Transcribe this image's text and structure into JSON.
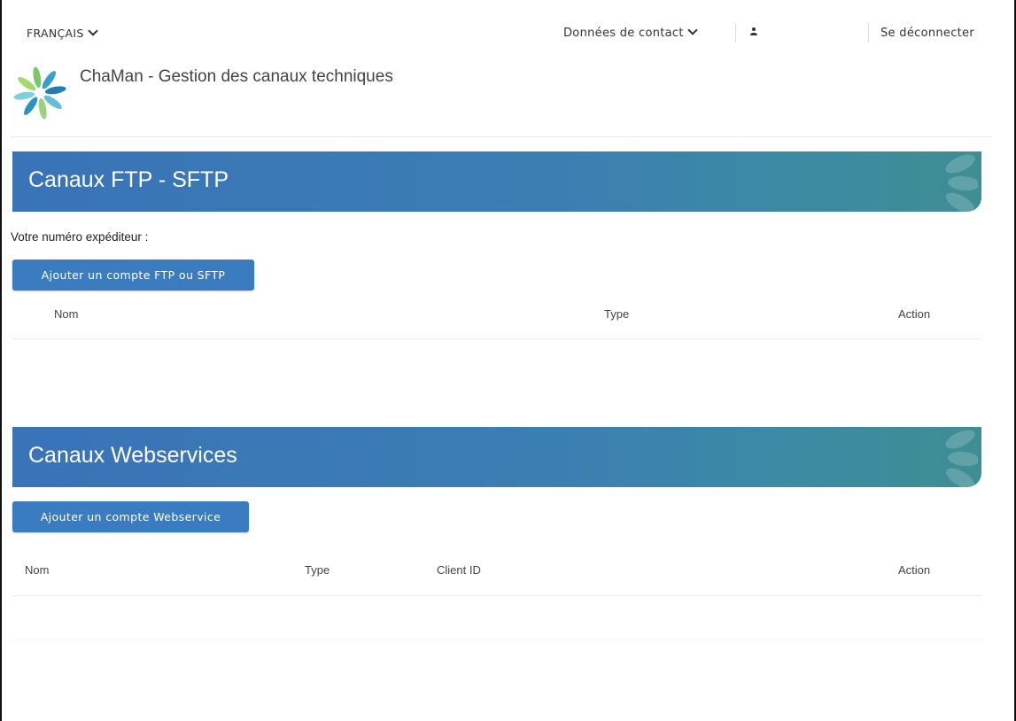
{
  "topbar": {
    "language": "FRANÇAIS",
    "contact": "Données de contact",
    "logout": "Se déconnecter"
  },
  "header": {
    "title": "ChaMan - Gestion des canaux techniques"
  },
  "ftp_section": {
    "title": "Canaux FTP - SFTP",
    "sender_label": "Votre numéro expéditeur :",
    "add_button": "Ajouter un compte FTP ou SFTP",
    "columns": [
      "Nom",
      "Type",
      "Action"
    ]
  },
  "ws_section": {
    "title": "Canaux Webservices",
    "add_button": "Ajouter un compte Webservice",
    "columns": [
      "Nom",
      "Type",
      "Client ID",
      "Action"
    ]
  },
  "colors": {
    "accent": "#3b7bbf",
    "banner_start": "#3a73b8",
    "banner_end": "#3e8e93"
  }
}
